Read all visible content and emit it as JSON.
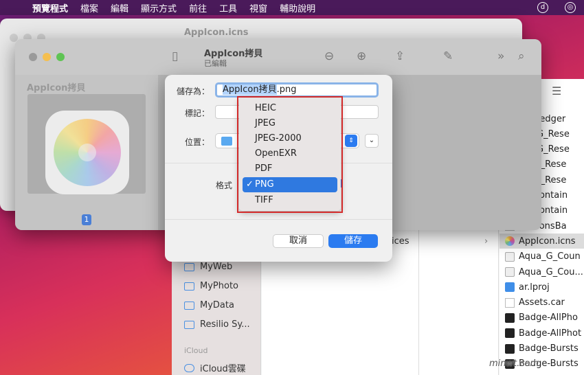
{
  "menubar": {
    "items": [
      "預覽程式",
      "檔案",
      "編輯",
      "顯示方式",
      "前往",
      "工具",
      "視窗",
      "輔助說明"
    ]
  },
  "finder": {
    "sidebar": {
      "items": [
        "MyWeb",
        "MyPhoto",
        "MyData",
        "Resilio Sy..."
      ],
      "icloud_header": "iCloud",
      "icloud_item": "iCloud雲碟"
    },
    "column2_item": "ices",
    "files": [
      {
        "name": "nowledger",
        "icon": "doc"
      },
      {
        "name": "UD_G_Rese",
        "icon": "doc"
      },
      {
        "name": "UD_G_Rese",
        "icon": "doc"
      },
      {
        "name": "sp_G_Rese",
        "icon": "doc"
      },
      {
        "name": "sp_G_Rese",
        "icon": "doc"
      },
      {
        "name": "umContain",
        "icon": "doc"
      },
      {
        "name": "umContain",
        "icon": "doc"
      },
      {
        "name": "otationsBa",
        "icon": "doc"
      },
      {
        "name": "AppIcon.icns",
        "icon": "flower"
      },
      {
        "name": "Aqua_G_Coun",
        "icon": "alias"
      },
      {
        "name": "Aqua_G_Cou...",
        "icon": "alias"
      },
      {
        "name": "ar.lproj",
        "icon": "folder"
      },
      {
        "name": "Assets.car",
        "icon": "doc"
      },
      {
        "name": "Badge-AllPho",
        "icon": "img"
      },
      {
        "name": "Badge-AllPhot",
        "icon": "img"
      },
      {
        "name": "Badge-Bursts",
        "icon": "img"
      },
      {
        "name": "Badge-Bursts",
        "icon": "img"
      }
    ]
  },
  "preview_back": {
    "title": "AppIcon.icns"
  },
  "preview_front": {
    "title": "AppIcon拷貝",
    "subtitle": "已編輯",
    "thumb_title": "AppIcon拷貝",
    "page_number": "1"
  },
  "save_dialog": {
    "save_as_label": "儲存為：",
    "filename_selected": "AppIcon拷貝",
    "filename_ext": ".png",
    "tags_label": "標記：",
    "location_label": "位置：",
    "format_label": "格式",
    "cancel_label": "取消",
    "save_label": "儲存"
  },
  "format_menu": {
    "options": [
      "HEIC",
      "JPEG",
      "JPEG-2000",
      "OpenEXR",
      "PDF",
      "PNG",
      "TIFF"
    ],
    "selected": "PNG",
    "check": "✓"
  },
  "watermark": "minwt.com"
}
